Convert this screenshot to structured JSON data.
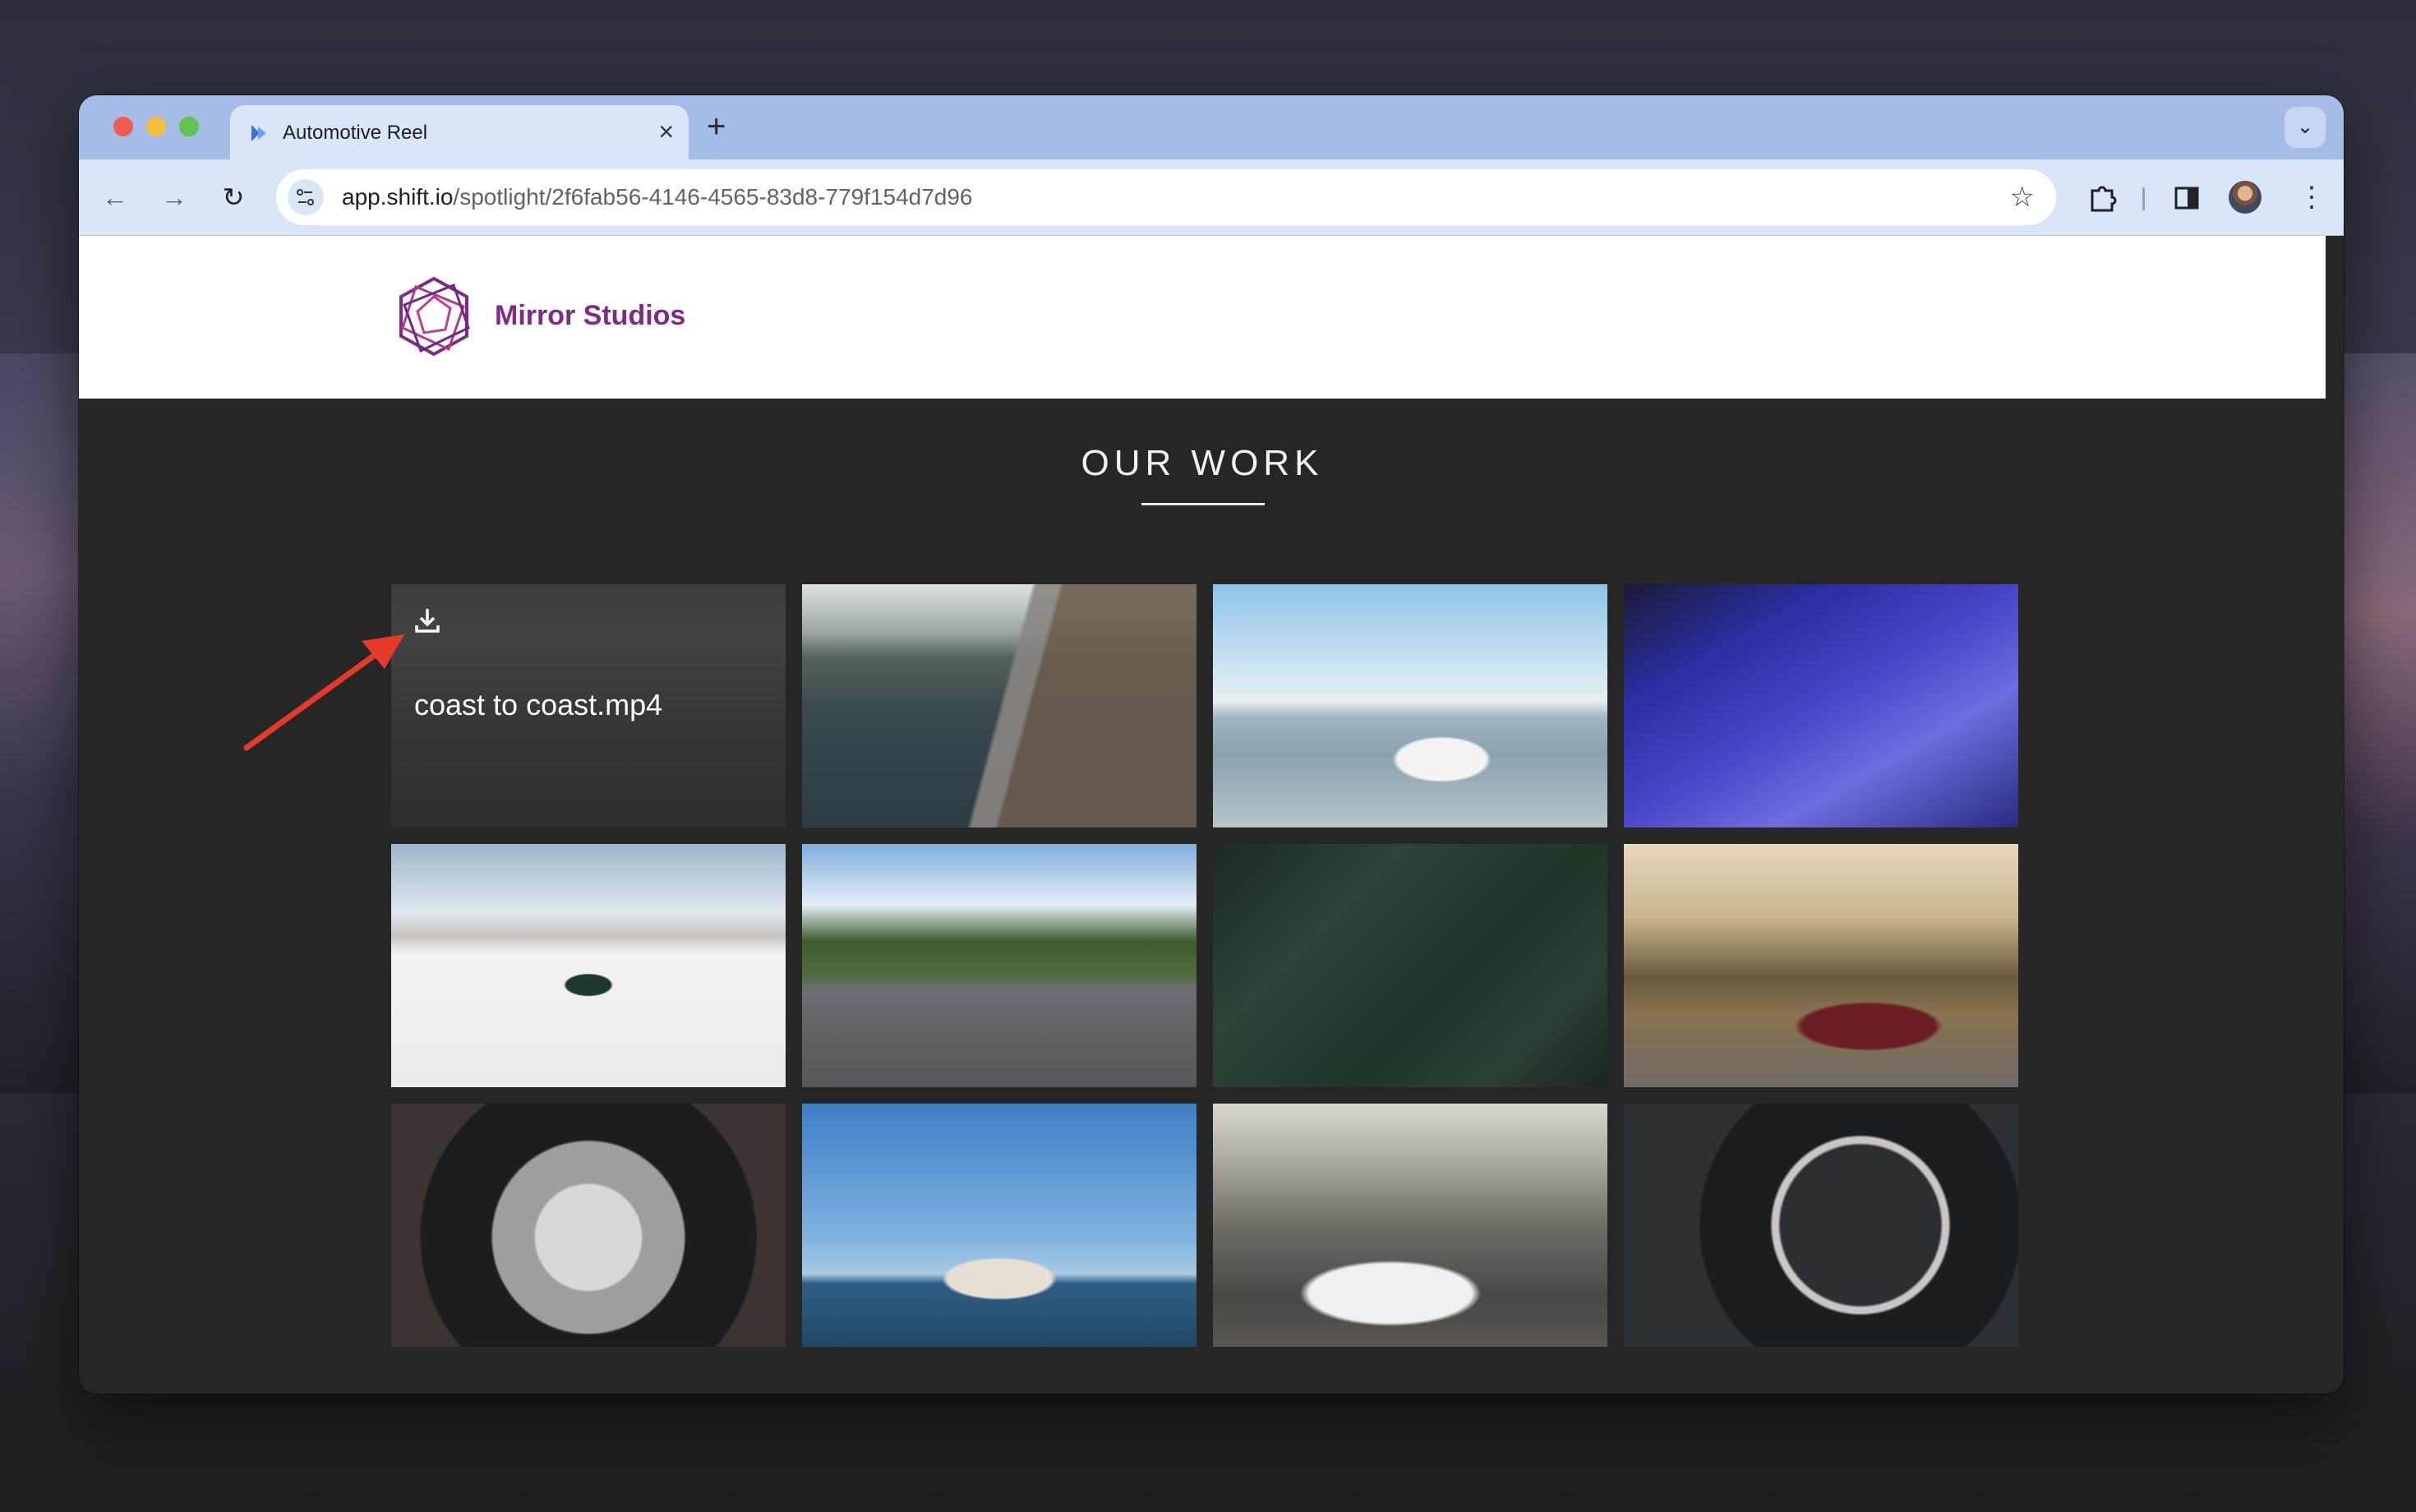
{
  "browser": {
    "tab_title": "Automotive Reel",
    "new_tab_symbol": "+",
    "close_symbol": "×",
    "url_host": "app.shift.io",
    "url_path": "/spotlight/2f6fab56-4146-4565-83d8-779f154d7d96",
    "icons": [
      "back-icon",
      "forward-icon",
      "reload-icon",
      "site-info-icon",
      "bookmark-star-icon",
      "extensions-icon",
      "side-panel-icon",
      "profile-avatar",
      "more-menu-icon",
      "tab-search-icon"
    ]
  },
  "site": {
    "brand": "Mirror Studios",
    "section_title": "OUR WORK"
  },
  "gallery": {
    "hovered_tile": {
      "file_name": "coast to coast.mp4",
      "action_icon": "download-icon"
    },
    "tiles": [
      {
        "subject": "coastal hillside dusk"
      },
      {
        "subject": "road across dam"
      },
      {
        "subject": "buggy on beach"
      },
      {
        "subject": "purple sports car hood"
      },
      {
        "subject": "car on salt flats"
      },
      {
        "subject": "mountain highway"
      },
      {
        "subject": "forest aerial road"
      },
      {
        "subject": "red coupe by trees"
      },
      {
        "subject": "alloy wheel close-up"
      },
      {
        "subject": "car on reflective water"
      },
      {
        "subject": "white sedan mountains"
      },
      {
        "subject": "speedometer gauge"
      }
    ]
  },
  "colors": {
    "tab_strip": "#a5bce6",
    "toolbar": "#dae5f8",
    "brand_purple": "#7f2a88",
    "page_bg": "#262626",
    "annotation_arrow": "#e53a2a"
  }
}
